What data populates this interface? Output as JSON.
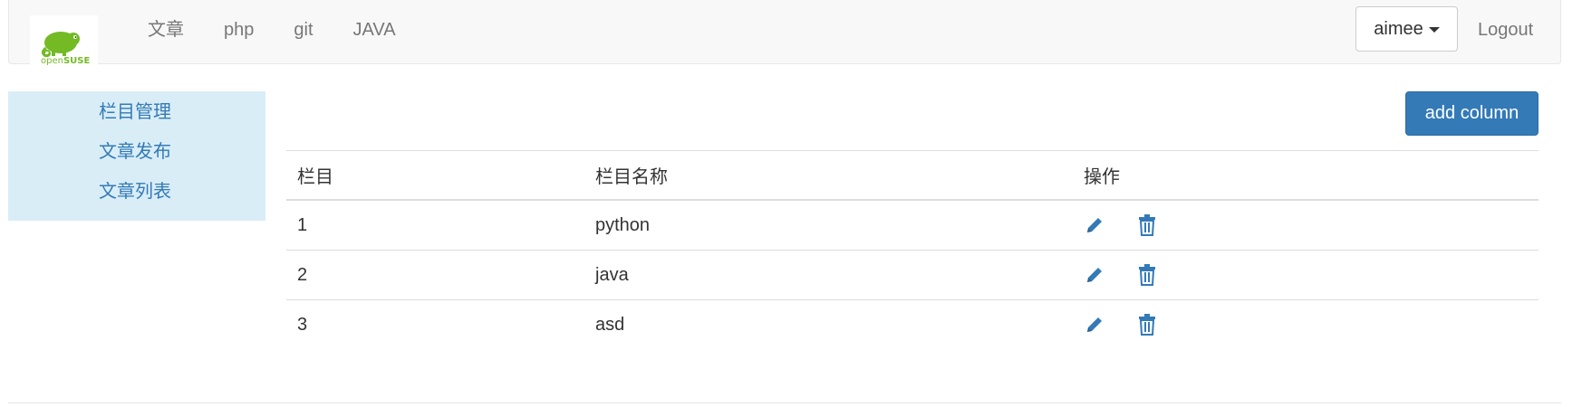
{
  "navbar": {
    "brand": {
      "logo": "opensuse-logo",
      "text_open": "open",
      "text_suse": "SUSE"
    },
    "links": [
      "文章",
      "php",
      "git",
      "JAVA"
    ],
    "user_menu": {
      "label": "aimee",
      "icon": "caret-down-icon"
    },
    "logout_label": "Logout"
  },
  "sidebar": {
    "items": [
      "栏目管理",
      "文章发布",
      "文章列表"
    ]
  },
  "toolbar": {
    "add_column_label": "add column"
  },
  "table": {
    "headers": [
      "栏目",
      "栏目名称",
      "操作"
    ],
    "rows": [
      {
        "id": "1",
        "name": "python"
      },
      {
        "id": "2",
        "name": "java"
      },
      {
        "id": "3",
        "name": "asd"
      }
    ],
    "action_icons": [
      "pencil-icon",
      "trash-icon"
    ]
  },
  "colors": {
    "primary": "#337ab7",
    "sidebar_bg": "#d9edf7",
    "navbar_bg": "#f8f8f8",
    "brand_green": "#73ba25"
  }
}
